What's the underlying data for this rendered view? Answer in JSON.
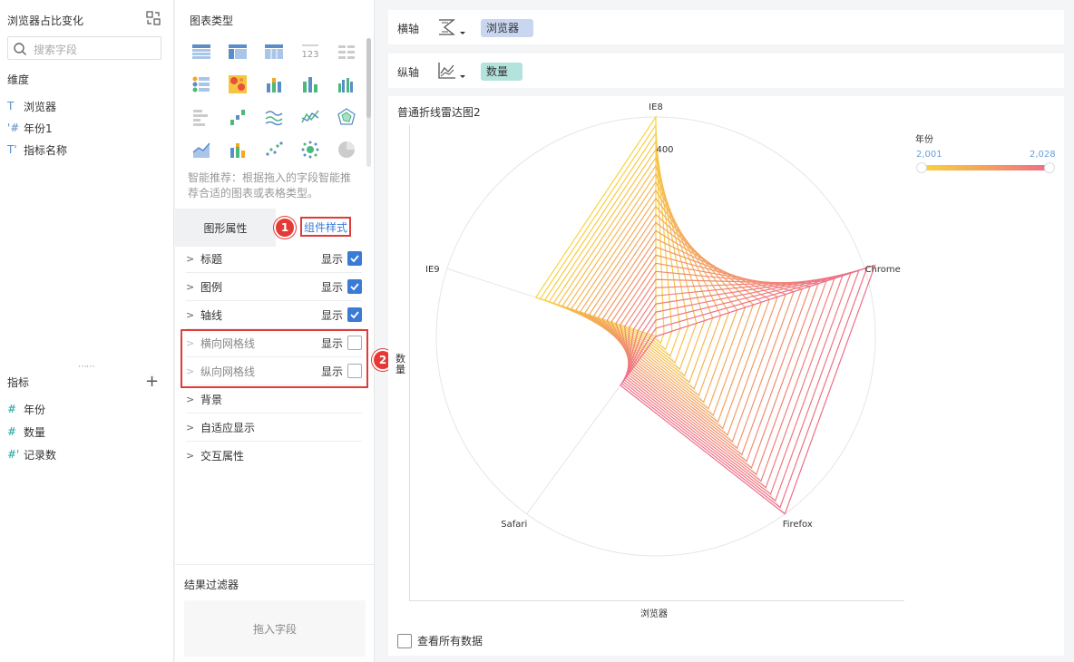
{
  "left": {
    "title": "浏览器占比变化",
    "search_placeholder": "搜索字段",
    "dimension_title": "维度",
    "dimensions": [
      {
        "icon": "text-icon",
        "glyph": "T",
        "label": "浏览器"
      },
      {
        "icon": "number-icon",
        "glyph": "'#",
        "label": "年份1"
      },
      {
        "icon": "text-formula-icon",
        "glyph": "T'",
        "label": "指标名称"
      }
    ],
    "metric_title": "指标",
    "metrics": [
      {
        "icon": "number-icon",
        "glyph": "#",
        "label": "年份"
      },
      {
        "icon": "number-icon",
        "glyph": "#",
        "label": "数量"
      },
      {
        "icon": "number-formula-icon",
        "glyph": "#'",
        "label": "记录数"
      }
    ]
  },
  "middle": {
    "chart_type_title": "图表类型",
    "hint": "智能推荐：根据拖入的字段智能推荐合适的图表或表格类型。",
    "tab_graph": "图形属性",
    "tab_style": "组件样式",
    "badge1": "1",
    "badge2": "2",
    "show_label": "显示",
    "rows": [
      {
        "label": "标题",
        "checked": true,
        "disabled": false
      },
      {
        "label": "图例",
        "checked": true,
        "disabled": false
      },
      {
        "label": "轴线",
        "checked": true,
        "disabled": false
      },
      {
        "label": "横向网格线",
        "checked": false,
        "disabled": true
      },
      {
        "label": "纵向网格线",
        "checked": false,
        "disabled": true
      },
      {
        "label": "背景"
      },
      {
        "label": "自适应显示"
      },
      {
        "label": "交互属性"
      }
    ],
    "filter_title": "结果过滤器",
    "filter_drop": "拖入字段"
  },
  "axes": {
    "x_label": "横轴",
    "x_field": "浏览器",
    "x_field_color": "#c9d6f0",
    "y_label": "纵轴",
    "y_field": "数量",
    "y_field_color": "#b3e3dc"
  },
  "chart": {
    "title": "普通折线雷达图2",
    "view_all": "查看所有数据",
    "chart_data": {
      "type": "radar-line",
      "axes_labels": [
        "IE8",
        "Chrome",
        "Firefox",
        "Safari",
        "IE9"
      ],
      "axis_max_label": "400",
      "xlabel": "浏览器",
      "ylabel": "数量",
      "legend_title": "年份",
      "legend_min": "2,001",
      "legend_max": "2,028",
      "color_start": "#f8d43e",
      "color_end": "#ef6d8a",
      "years_from": 2001,
      "years_to": 2028,
      "series_start": [
        400,
        0,
        0,
        0,
        230
      ],
      "series_end": [
        0,
        420,
        400,
        110,
        0
      ]
    }
  }
}
